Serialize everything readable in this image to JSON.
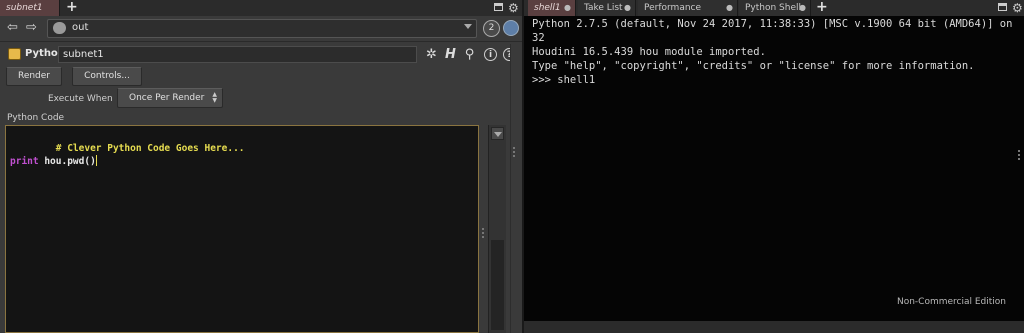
{
  "left_pane": {
    "tabs": [
      {
        "label": "subnet1",
        "active": true
      }
    ],
    "path": {
      "value": "out",
      "pin_label": "2"
    },
    "node": {
      "type_label": "Python",
      "name": "subnet1"
    },
    "buttons": {
      "render": "Render",
      "controls": "Controls..."
    },
    "execute_when": {
      "label": "Execute When",
      "value": "Once Per Render"
    },
    "python_code": {
      "label": "Python Code",
      "line1": "# Clever Python Code Goes Here...",
      "line2_keyword": "print",
      "line2_rest": " hou.pwd()"
    }
  },
  "right_pane": {
    "tabs": [
      {
        "label": "shell1",
        "active": true
      },
      {
        "label": "Take List"
      },
      {
        "label": "Performance Monitor"
      },
      {
        "label": "Python Shell"
      }
    ],
    "console_text": "Python 2.7.5 (default, Nov 24 2017, 11:38:33) [MSC v.1900 64 bit (AMD64)] on\n32\nHoudini 16.5.439 hou module imported.\nType \"help\", \"copyright\", \"credits\" or \"license\" for more information.\n>>> shell1",
    "watermark": "Non-Commercial Edition"
  },
  "icons": {
    "back": "back-arrow-icon",
    "forward": "forward-arrow-icon",
    "network": "network-context-icon",
    "gear": "gear-icon",
    "help": "help-icon",
    "search": "search-icon",
    "info": "info-icon"
  },
  "colors": {
    "active_tab": "#5a3f40",
    "comment": "#e6dc50",
    "keyword": "#c050d0",
    "editor_border": "#8a7440"
  }
}
